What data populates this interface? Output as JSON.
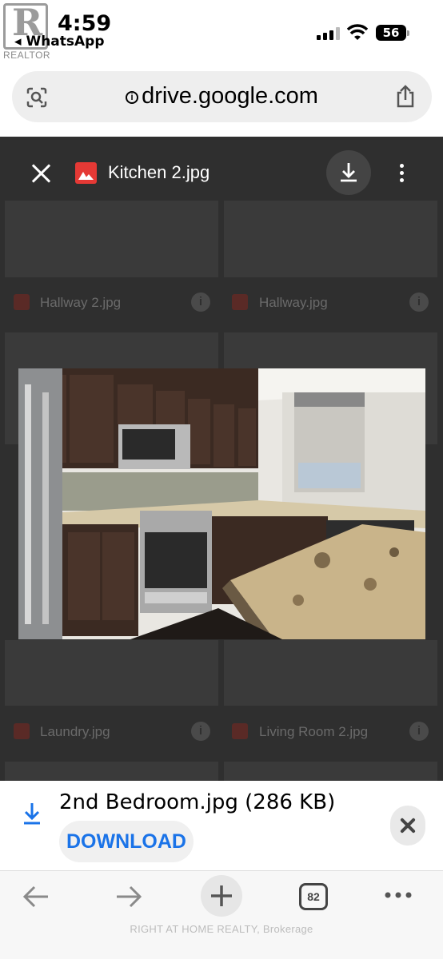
{
  "status": {
    "time": "4:59",
    "back_app": "WhatsApp",
    "battery": "56"
  },
  "watermark_top": "REALTOR",
  "address_bar": {
    "url": "drive.google.com"
  },
  "viewer": {
    "file_name": "Kitchen 2.jpg",
    "background_files": [
      {
        "label": "Hallway 2.jpg"
      },
      {
        "label": "Hallway.jpg"
      },
      {
        "label": "Laundry.jpg"
      },
      {
        "label": "Living Room 2.jpg"
      }
    ]
  },
  "download_banner": {
    "file_info": "2nd Bedroom.jpg (286 KB)",
    "button_label": "DOWNLOAD"
  },
  "toolbar": {
    "tabs_count": "82"
  },
  "watermark_bottom": "RIGHT AT HOME REALTY, Brokerage",
  "colors": {
    "accent": "#1a73e8",
    "viewer_bg": "#2f2f2f",
    "file_icon": "#e53935"
  }
}
